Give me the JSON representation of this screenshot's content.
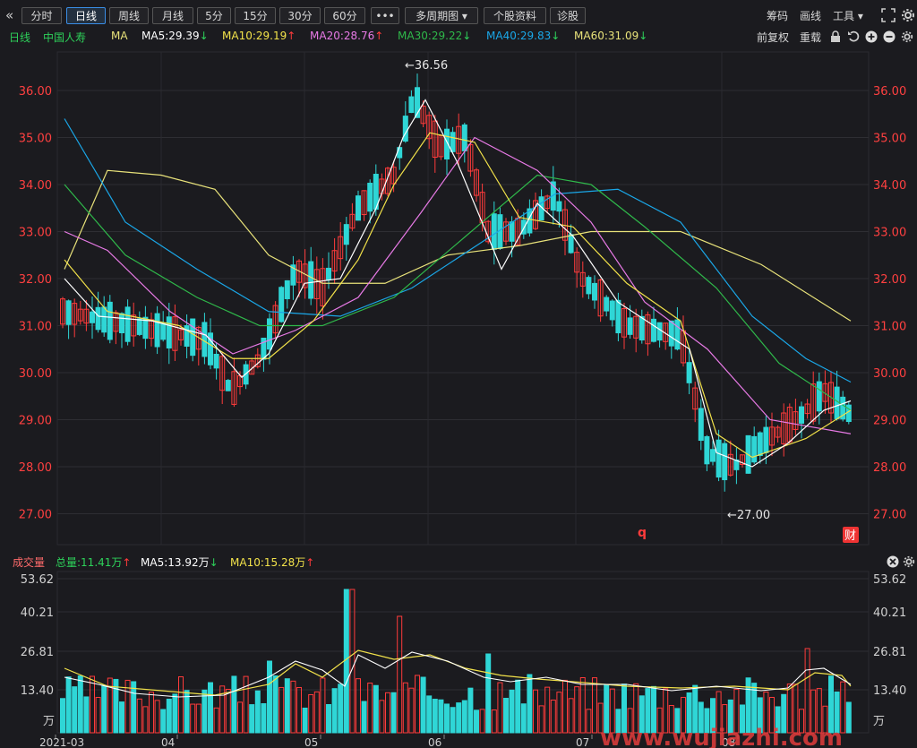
{
  "toolbar": {
    "collapse_icon": "«",
    "tabs": [
      "分时",
      "日线",
      "周线",
      "月线",
      "5分",
      "15分",
      "30分",
      "60分",
      "•••",
      "多周期图 ▾",
      "个股资料",
      "诊股"
    ],
    "active_tab": 1,
    "right": {
      "chips": "筹码",
      "draw": "画线",
      "tools": "工具 ▾"
    }
  },
  "ma_bar": {
    "period": "日线",
    "stock": "中国人寿",
    "ma_label": "MA",
    "items": [
      {
        "text": "MA5:29.39",
        "arrow": "↓",
        "color": "#ffffff",
        "dir": "dn"
      },
      {
        "text": "MA10:29.19",
        "arrow": "↑",
        "color": "#f2e24a",
        "dir": "up"
      },
      {
        "text": "MA20:28.76",
        "arrow": "↑",
        "color": "#e87ae6",
        "dir": "up"
      },
      {
        "text": "MA30:29.22",
        "arrow": "↓",
        "color": "#2fb84a",
        "dir": "dn"
      },
      {
        "text": "MA40:29.83",
        "arrow": "↓",
        "color": "#1aa7e8",
        "dir": "dn"
      },
      {
        "text": "MA60:31.09",
        "arrow": "↓",
        "color": "#e8e27a",
        "dir": "dn"
      }
    ],
    "adjust": "前复权",
    "reset": "重载"
  },
  "price_axis": {
    "labels": [
      "36.00",
      "35.00",
      "34.00",
      "33.00",
      "32.00",
      "31.00",
      "30.00",
      "29.00",
      "28.00",
      "27.00"
    ]
  },
  "annotations": {
    "high": "←36.56",
    "low": "←27.00",
    "marker_q": "q",
    "finance_badge": "财"
  },
  "vol_bar": {
    "title": "成交量",
    "total": "总量:11.41万",
    "total_arrow": "↑",
    "ma5": "MA5:13.92万",
    "ma5_arrow": "↓",
    "ma10": "MA10:15.28万",
    "ma10_arrow": "↑"
  },
  "vol_axis": {
    "labels": [
      "53.62",
      "40.21",
      "26.81",
      "13.40"
    ],
    "unit": "万"
  },
  "time_axis": {
    "labels": [
      "2021-03",
      "04",
      "05",
      "06",
      "07",
      "08"
    ]
  },
  "watermark": "www.wujiazhi.com",
  "colors": {
    "up": "#ff3b3b",
    "down": "#2fd6d6",
    "bg": "#1b1b1f",
    "grid": "#2e2e33",
    "axis_red": "#ff4040"
  }
}
